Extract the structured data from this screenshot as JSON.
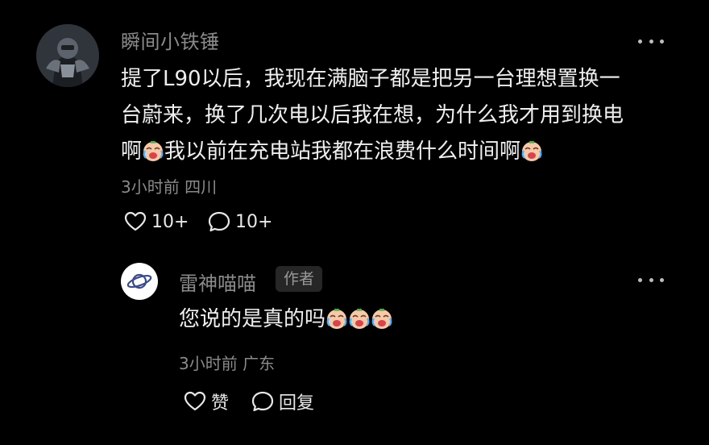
{
  "comment": {
    "username": "瞬间小铁锤",
    "text_line1": "提了L90以后，我现在满脑子都是把另一台理想置换一",
    "text_line2": "台蔚来，换了几次电以后我在想，为什么我才用到换电",
    "text_line3a": "啊",
    "text_line3b": "我以前在充电站我都在浪费什么时间啊",
    "meta": "3小时前 四川",
    "likes": "10+",
    "replies": "10+"
  },
  "reply": {
    "username": "雷神喵喵",
    "badge": "作者",
    "text": "您说的是真的吗",
    "meta": "3小时前 广东",
    "like_label": "赞",
    "reply_label": "回复"
  },
  "colors": {
    "background": "#000000",
    "text_primary": "#efefef",
    "text_secondary": "#8a8a8a",
    "badge_bg": "#262626"
  },
  "icons": {
    "avatar_main": "robot-mech-avatar",
    "avatar_reply": "saturn-icon",
    "emoji": "crying-laughing-emoji",
    "more": "more-dots-icon",
    "like": "heart-outline-icon",
    "comment": "comment-bubble-icon"
  }
}
